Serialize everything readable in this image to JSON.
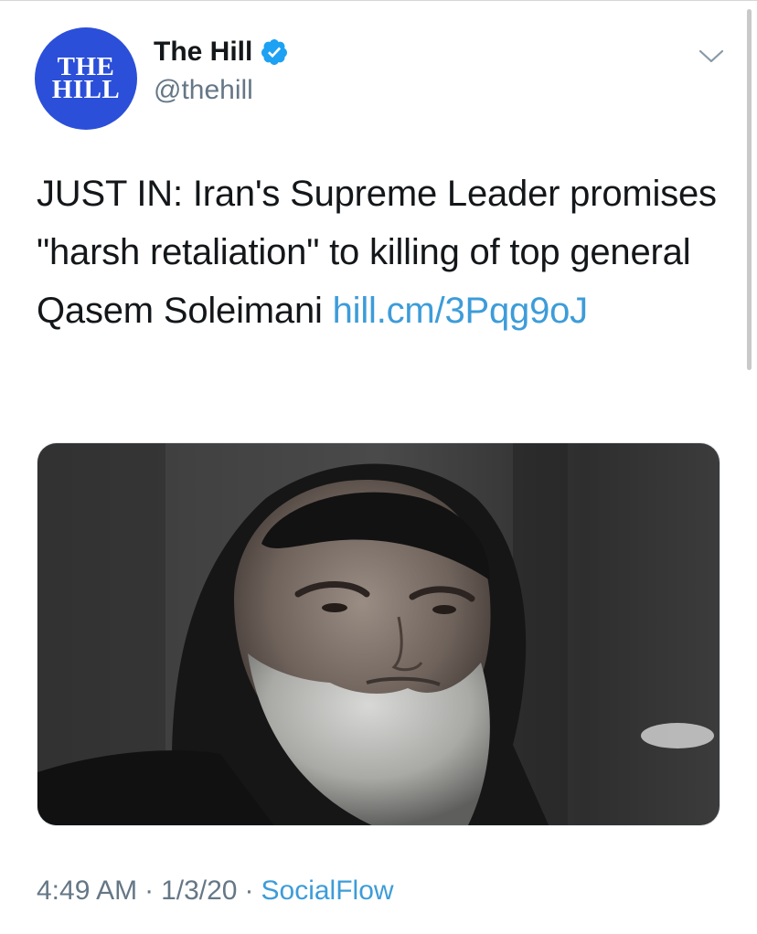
{
  "author": {
    "avatar_lines": [
      "THE",
      "HILL"
    ],
    "display_name": "The Hill",
    "verified": true,
    "handle": "@thehill"
  },
  "tweet": {
    "text": "JUST IN: Iran's Supreme Leader promises \"harsh retaliation\" to killing of top general Qasem Soleimani ",
    "link_text": "hill.cm/3Pqg9oJ",
    "media": {
      "type": "photo",
      "description_icon": "portrait-photo"
    }
  },
  "meta": {
    "time": "4:49 AM",
    "separator": "·",
    "date": "1/3/20",
    "source": "SocialFlow"
  },
  "icons": {
    "verified": "verified-badge-icon",
    "menu": "chevron-down-icon"
  },
  "colors": {
    "avatar_bg": "#2b4fd8",
    "link": "#3d9cd9",
    "verified": "#1da1f2",
    "muted_text": "#657786",
    "text": "#14171a"
  }
}
